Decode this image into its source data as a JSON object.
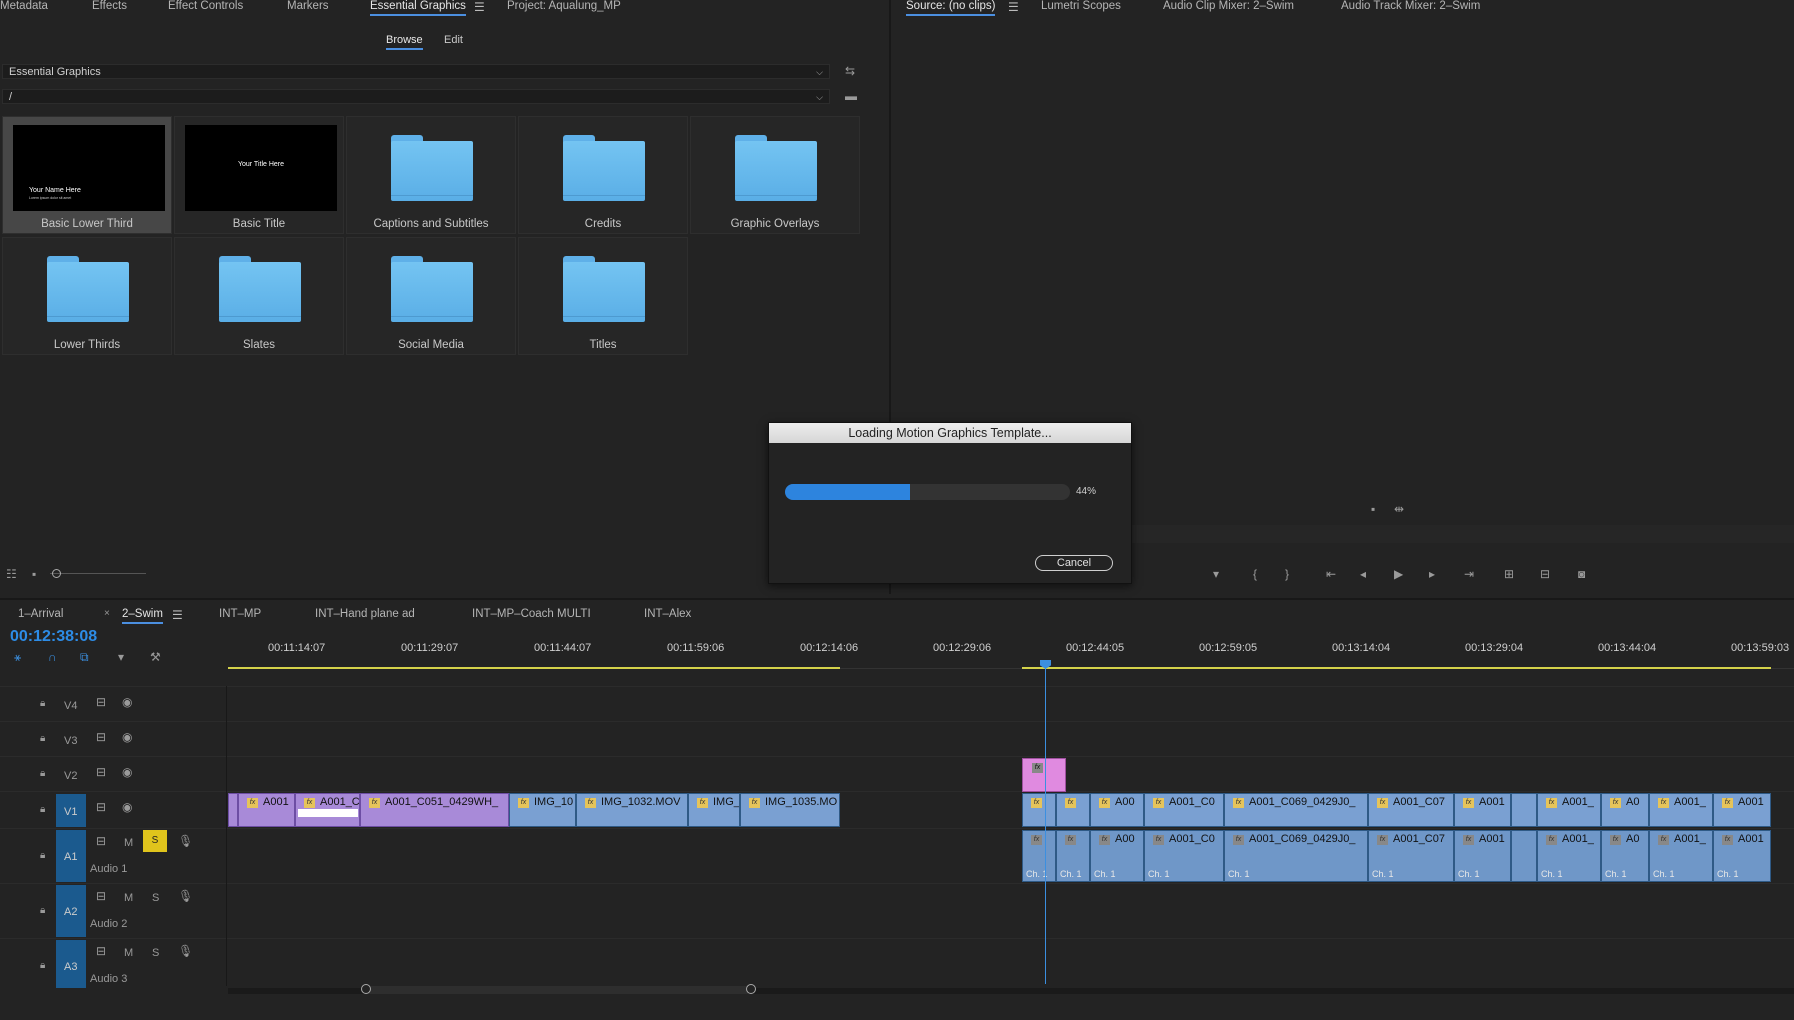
{
  "top_tabs_left": [
    "Metadata",
    "Effects",
    "Effect Controls",
    "Markers",
    "Essential Graphics",
    "Project: Aqualung_MP"
  ],
  "top_tabs_right": [
    "Source: (no clips)",
    "Lumetri Scopes",
    "Audio Clip Mixer: 2–Swim",
    "Audio Track Mixer: 2–Swim"
  ],
  "essential_graphics": {
    "subtabs": [
      "Browse",
      "Edit"
    ],
    "library_dropdown": "Essential Graphics",
    "path_dropdown": "/",
    "items": [
      {
        "label": "Basic Lower Third",
        "type": "template",
        "thumb_text": "Your Name Here",
        "thumb_subtext": "Lorem ipsum dolor sit amet"
      },
      {
        "label": "Basic Title",
        "type": "template",
        "thumb_text": "Your Title Here"
      },
      {
        "label": "Captions and Subtitles",
        "type": "folder"
      },
      {
        "label": "Credits",
        "type": "folder"
      },
      {
        "label": "Graphic Overlays",
        "type": "folder"
      },
      {
        "label": "Lower Thirds",
        "type": "folder"
      },
      {
        "label": "Slates",
        "type": "folder"
      },
      {
        "label": "Social Media",
        "type": "folder"
      },
      {
        "label": "Titles",
        "type": "folder"
      }
    ]
  },
  "dialog": {
    "title": "Loading Motion Graphics Template...",
    "progress": 0.44,
    "progress_text": "44%",
    "cancel_label": "Cancel"
  },
  "timeline": {
    "sequence_tabs": [
      "1–Arrival",
      "2–Swim",
      "INT–MP",
      "INT–Hand plane ad",
      "INT–MP–Coach MULTI",
      "INT–Alex"
    ],
    "timecode": "00:12:38:08",
    "ruler": [
      "00:11:14:07",
      "00:11:29:07",
      "00:11:44:07",
      "00:11:59:06",
      "00:12:14:06",
      "00:12:29:06",
      "00:12:44:05",
      "00:12:59:05",
      "00:13:14:04",
      "00:13:29:04",
      "00:13:44:04",
      "00:13:59:03"
    ],
    "tracks": [
      {
        "id": "V4"
      },
      {
        "id": "V3"
      },
      {
        "id": "V2"
      },
      {
        "id": "V1"
      },
      {
        "id": "A1",
        "name": "Audio 1",
        "mute": "M",
        "solo": "S"
      },
      {
        "id": "A2",
        "name": "Audio 2",
        "mute": "M",
        "solo": "S"
      },
      {
        "id": "A3",
        "name": "Audio 3",
        "mute": "M",
        "solo": "S"
      }
    ],
    "v1_clips": [
      "A001",
      "A001_C",
      "A001_C051_0429WH_",
      "IMG_10",
      "IMG_1032.MOV",
      "IMG_",
      "IMG_1035.MO",
      "A00",
      "A001_C0",
      "A001_C069_0429J0_",
      "A001_C07",
      "A001",
      "A001_",
      "A0",
      "A001_",
      "A001"
    ],
    "a1_clips": [
      "A00",
      "A001_C0",
      "A001_C069_0429J0_",
      "A001_C07",
      "A001",
      "A001_",
      "A0",
      "A001_",
      "A001"
    ],
    "channel_label": "Ch. 1"
  }
}
